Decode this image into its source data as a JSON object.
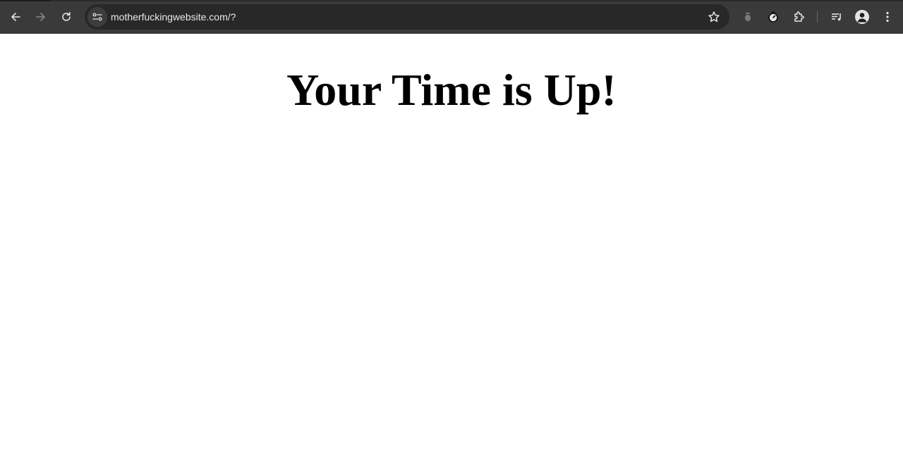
{
  "browser": {
    "url": "motherfuckingwebsite.com/?",
    "toolbar_color": "#3a3a3a",
    "omnibox_color": "#282828",
    "icons": {
      "back": "arrow-left-icon",
      "forward": "arrow-right-icon",
      "reload": "reload-icon",
      "site_info": "tune-icon",
      "bookmark": "star-icon",
      "extension_1": "extension-dot-icon",
      "timer": "stopwatch-icon",
      "extensions": "puzzle-icon",
      "reading_list": "playlist-icon",
      "profile": "person-icon",
      "menu": "more-vert-icon"
    }
  },
  "page": {
    "heading": "Your Time is Up!",
    "background": "#ffffff",
    "text_color": "#000000"
  }
}
